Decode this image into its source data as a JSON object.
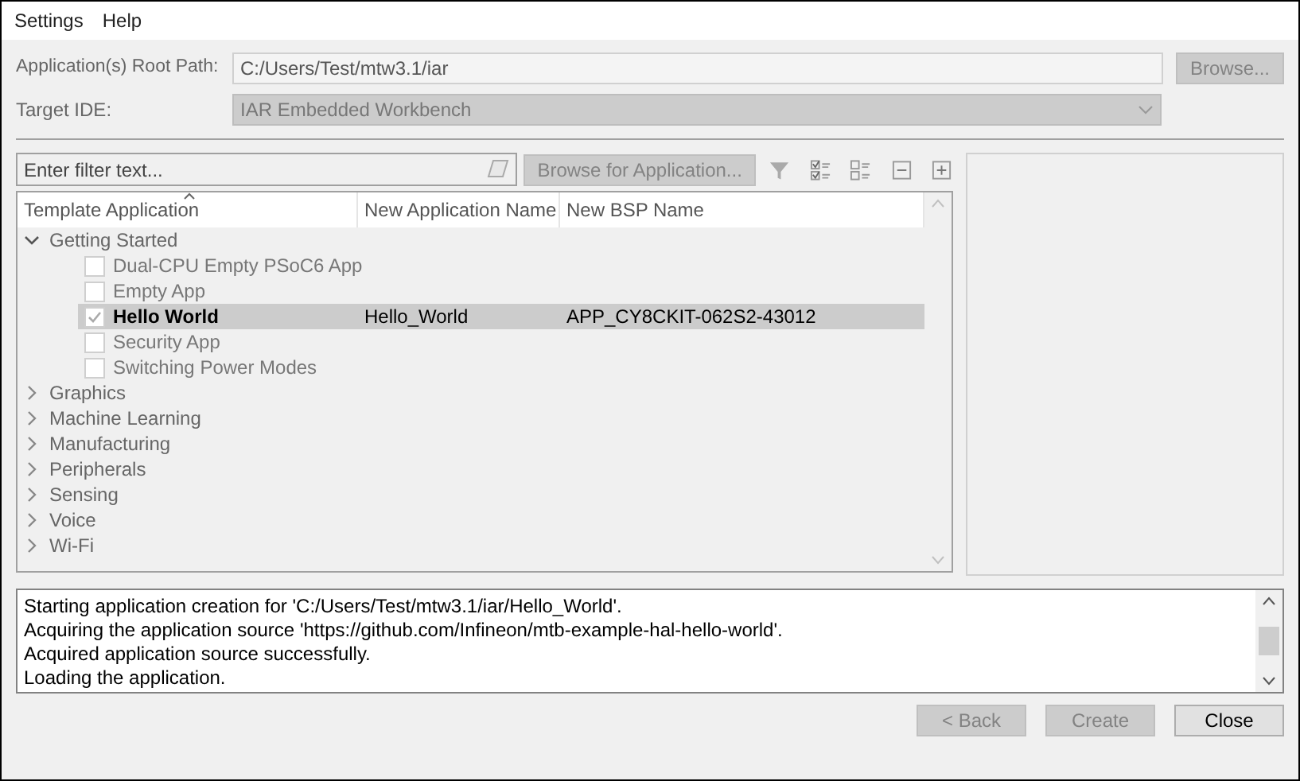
{
  "menu": [
    {
      "label": "Settings"
    },
    {
      "label": "Help"
    }
  ],
  "root_path": {
    "label": "Application(s) Root Path:",
    "value": "C:/Users/Test/mtw3.1/iar",
    "button": {
      "label": "Browse...",
      "disabled": true
    }
  },
  "target_ide": {
    "label": "Target IDE:",
    "value": "IAR Embedded Workbench",
    "disabled": true
  },
  "filter": {
    "placeholder": "Enter filter text..."
  },
  "browse_app_button": {
    "label": "Browse for Application...",
    "disabled": true
  },
  "tree": {
    "columns": [
      "Template Application",
      "New Application Name",
      "New BSP Name"
    ],
    "rows": [
      {
        "label": "Getting Started",
        "expanded": true,
        "children": [
          {
            "label": "Dual-CPU Empty PSoC6 App",
            "checked": false,
            "selected": false
          },
          {
            "label": "Empty App",
            "checked": false,
            "selected": false
          },
          {
            "label": "Hello World",
            "checked": true,
            "selected": true,
            "app_name": "Hello_World",
            "bsp_name": "APP_CY8CKIT-062S2-43012"
          },
          {
            "label": "Security App",
            "checked": false,
            "selected": false
          },
          {
            "label": "Switching Power Modes",
            "checked": false,
            "selected": false
          }
        ]
      },
      {
        "label": "Graphics",
        "expanded": false
      },
      {
        "label": "Machine Learning",
        "expanded": false
      },
      {
        "label": "Manufacturing",
        "expanded": false
      },
      {
        "label": "Peripherals",
        "expanded": false
      },
      {
        "label": "Sensing",
        "expanded": false
      },
      {
        "label": "Voice",
        "expanded": false
      },
      {
        "label": "Wi-Fi",
        "expanded": false
      }
    ]
  },
  "log": [
    "Starting application creation for 'C:/Users/Test/mtw3.1/iar/Hello_World'.",
    "Acquiring the application source 'https://github.com/Infineon/mtb-example-hal-hello-world'.",
    "Acquired application source successfully.",
    "Loading the application."
  ],
  "buttons": [
    {
      "label": "< Back",
      "disabled": true
    },
    {
      "label": "Create",
      "disabled": true
    },
    {
      "label": "Close",
      "disabled": false
    }
  ]
}
